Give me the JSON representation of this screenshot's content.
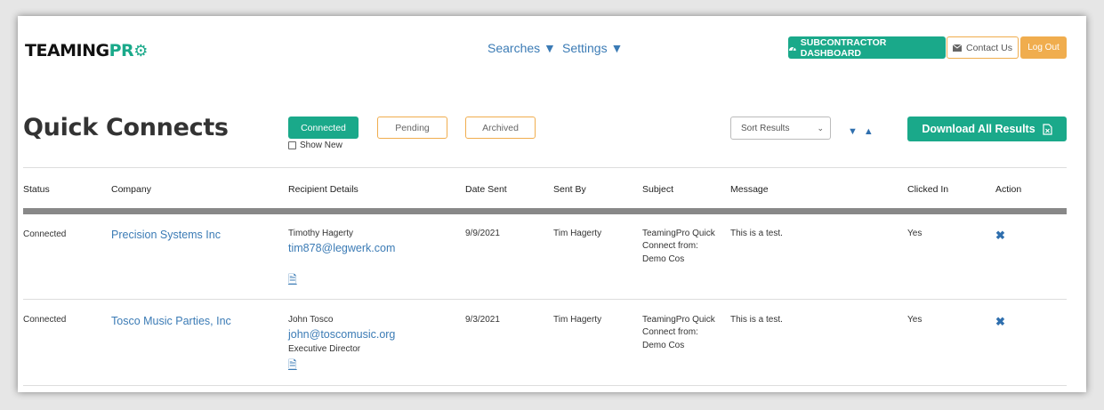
{
  "brand": {
    "logo_part1": "TEAMING",
    "logo_part2": "PR",
    "logo_gear": "⚙"
  },
  "nav": {
    "searches": "Searches ▼",
    "settings": "Settings ▼"
  },
  "header_buttons": {
    "subcontractor": "SUBCONTRACTOR DASHBOARD",
    "contact": "Contact Us",
    "logout": "Log Out"
  },
  "page": {
    "title": "Quick Connects",
    "tabs": {
      "connected": "Connected",
      "pending": "Pending",
      "archived": "Archived"
    },
    "show_new": "Show New",
    "sort_placeholder": "Sort Results",
    "download": "Download All Results"
  },
  "table": {
    "headers": {
      "status": "Status",
      "company": "Company",
      "recipient": "Recipient Details",
      "date": "Date Sent",
      "sentby": "Sent By",
      "subject": "Subject",
      "message": "Message",
      "clicked": "Clicked In",
      "action": "Action"
    },
    "rows": [
      {
        "status": "Connected",
        "company": "Precision Systems Inc",
        "recipient_name": "Timothy Hagerty",
        "recipient_email": "tim878@legwerk.com",
        "recipient_title": "",
        "date": "9/9/2021",
        "sent_by": "Tim Hagerty",
        "subject_1": "TeamingPro Quick",
        "subject_2": "Connect from:",
        "subject_3": "Demo Cos",
        "message": "This is a test.",
        "clicked": "Yes"
      },
      {
        "status": "Connected",
        "company": "Tosco Music Parties, Inc",
        "recipient_name": "John Tosco",
        "recipient_email": "john@toscomusic.org",
        "recipient_title": "Executive Director",
        "date": "9/3/2021",
        "sent_by": "Tim Hagerty",
        "subject_1": "TeamingPro Quick",
        "subject_2": "Connect from:",
        "subject_3": "Demo Cos",
        "message": "This is a test.",
        "clicked": "Yes"
      }
    ]
  },
  "colors": {
    "accent": "#1aa98a",
    "warning": "#f0ad4e",
    "link": "#3b7bb5"
  }
}
